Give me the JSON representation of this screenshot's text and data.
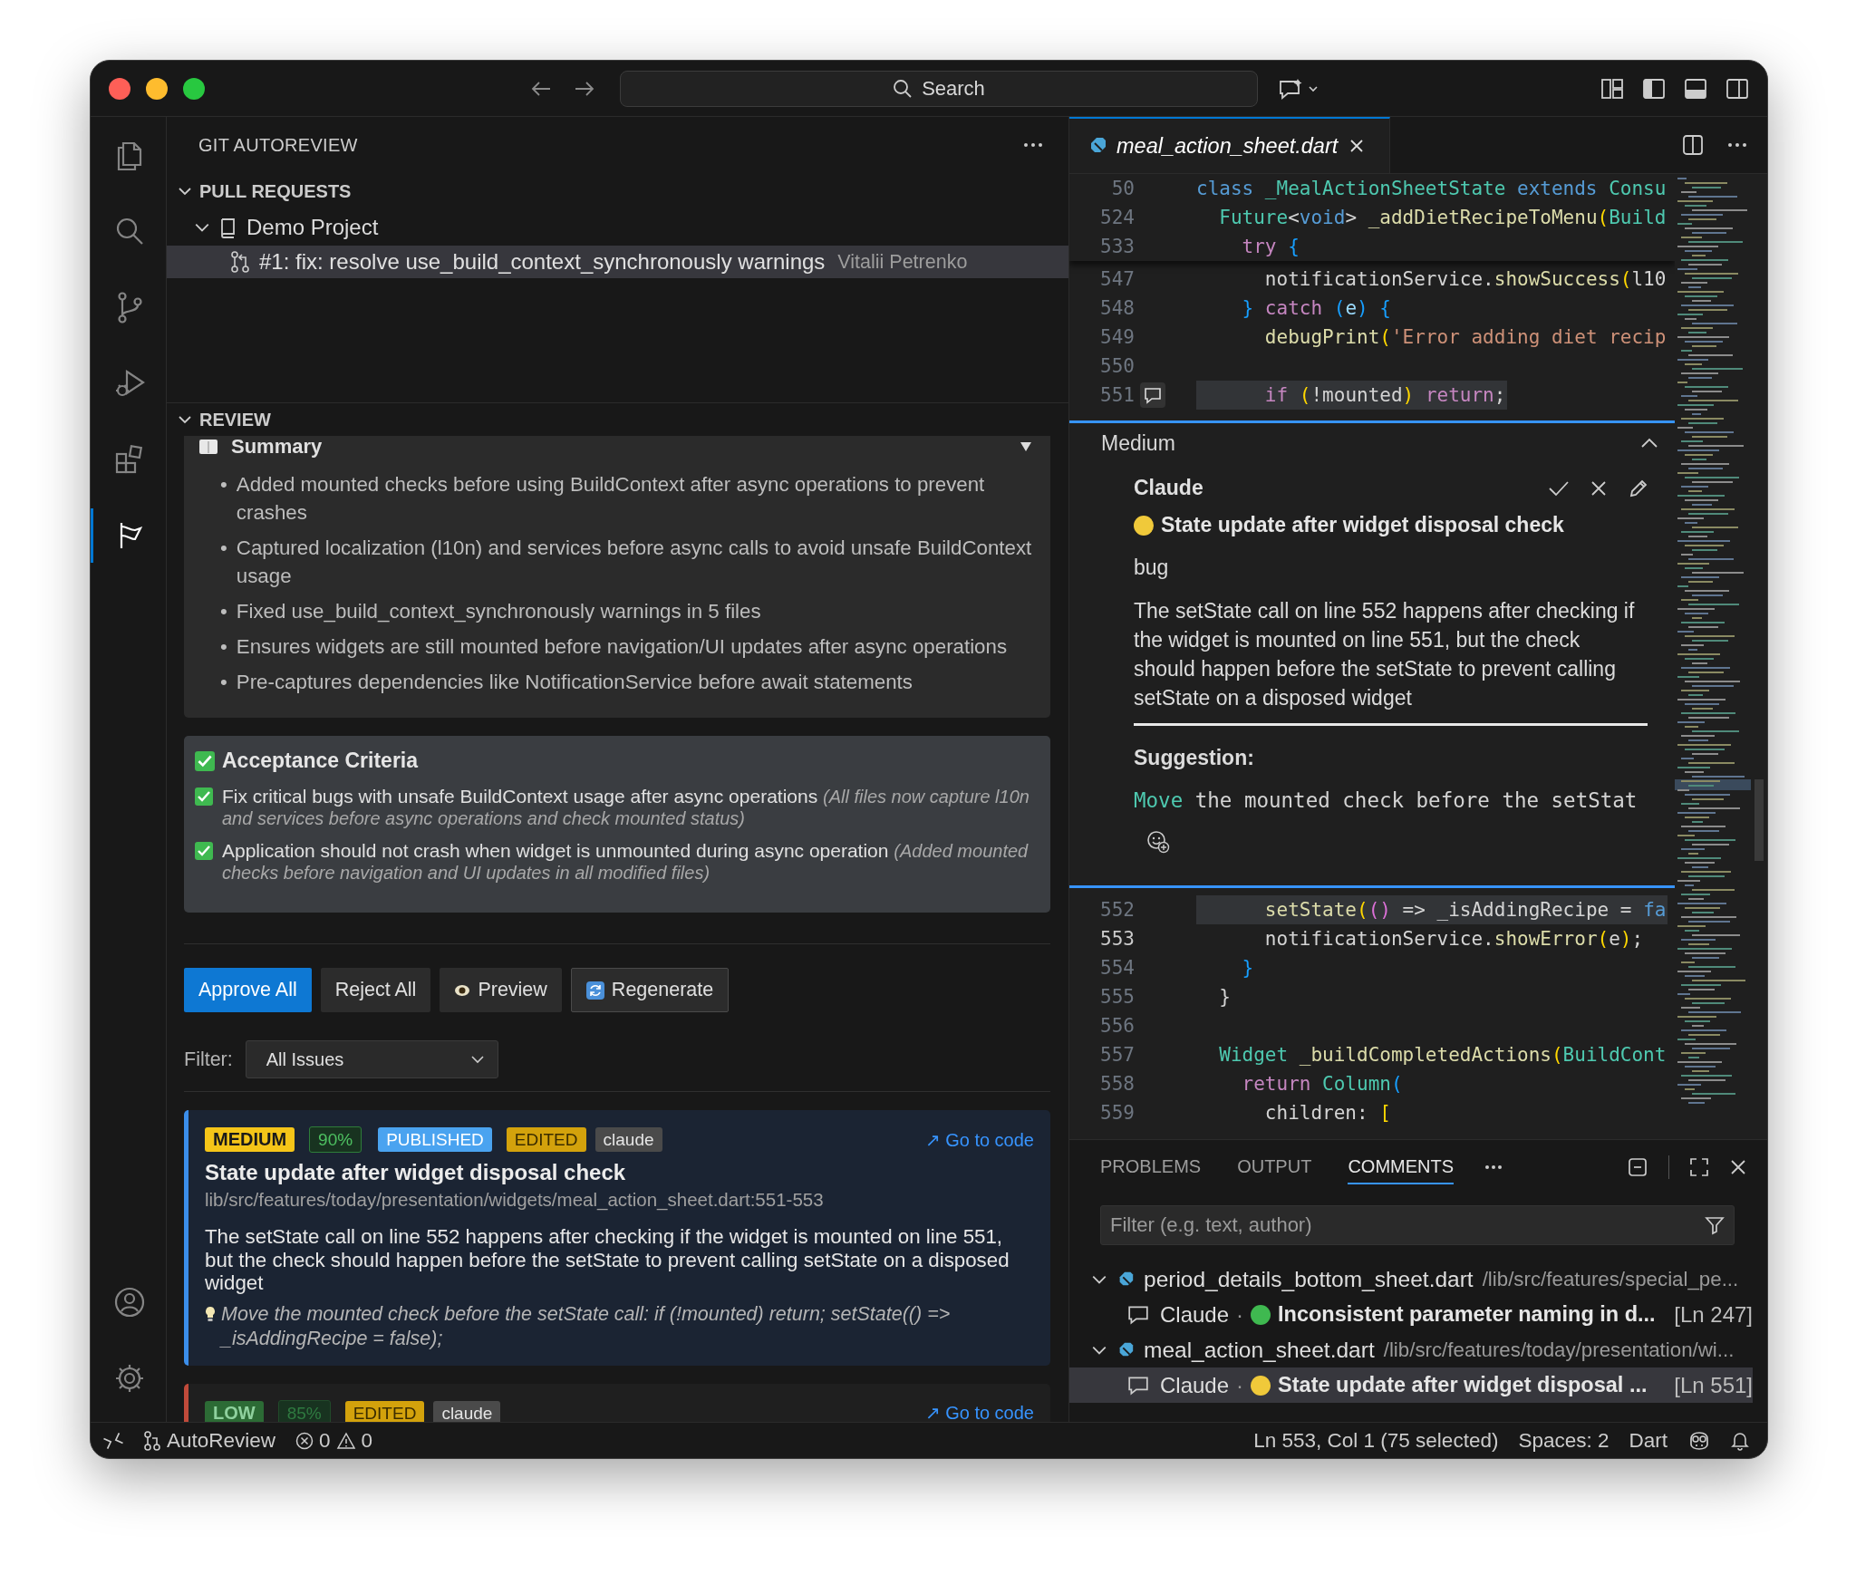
{
  "titlebar": {
    "search": "Search"
  },
  "activity_bar": {
    "top": [
      {
        "kind": "explorer",
        "selected": false
      },
      {
        "kind": "search",
        "selected": false
      },
      {
        "kind": "source_control",
        "selected": false
      },
      {
        "kind": "run_debug",
        "selected": false
      },
      {
        "kind": "extensions",
        "selected": false
      },
      {
        "kind": "autoreview",
        "selected": true
      }
    ],
    "bottom": [
      {
        "kind": "account"
      },
      {
        "kind": "settings"
      }
    ]
  },
  "sidebar": {
    "title": "GIT AUTOREVIEW",
    "pull_requests": {
      "label": "PULL REQUESTS",
      "expanded": true,
      "projects": [
        {
          "name": "Demo Project",
          "expanded": true,
          "children": [
            {
              "title": "#1: fix: resolve use_build_context_synchronously warnings",
              "author": "Vitalii Petrenko",
              "selected": true
            }
          ]
        }
      ]
    },
    "review": {
      "label": "REVIEW",
      "expanded": true,
      "summary": {
        "title": "Summary",
        "expanded": true,
        "bullet": "•",
        "items": [
          "Added mounted checks before using BuildContext after async operations to prevent crashes",
          "Captured localization (l10n) and services before async calls to avoid unsafe BuildContext usage",
          "Fixed use_build_context_synchronously warnings in 5 files",
          "Ensures widgets are still mounted before navigation/UI updates after async operations",
          "Pre-captures dependencies like NotificationService before await statements"
        ]
      },
      "acceptance": {
        "title": "Acceptance Criteria",
        "items": [
          {
            "text": "Fix critical bugs with unsafe BuildContext usage after async operations",
            "note": "(All files now capture l10n and services before async operations and check mounted status)",
            "checked": true
          },
          {
            "text": "Application should not crash when widget is unmounted during async operation",
            "note": "(Added mounted checks before navigation and UI updates in all modified files)",
            "checked": true
          }
        ]
      },
      "actions": [
        {
          "label": "Approve All",
          "kind": "primary"
        },
        {
          "label": "Reject All",
          "kind": "secondary"
        },
        {
          "label": "Preview",
          "kind": "preview"
        },
        {
          "label": "Regenerate",
          "kind": "regenerate"
        }
      ],
      "filter": {
        "label": "Filter:",
        "value": "All Issues"
      },
      "issues": [
        {
          "severity": "MEDIUM",
          "kind": "medium",
          "confidence": "90%",
          "tags": [
            {
              "label": "PUBLISHED",
              "kind": "published"
            },
            {
              "label": "EDITED",
              "kind": "edited"
            },
            {
              "label": "claude",
              "kind": "model"
            }
          ],
          "link": "↗ Go to code",
          "title": "State update after widget disposal check",
          "location": "lib/src/features/today/presentation/widgets/meal_action_sheet.dart:551-553",
          "description": "The setState call on line 552 happens after checking if the widget is mounted on line 551, but the check should happen before the setState to prevent calling setState on a disposed widget",
          "suggestion": "Move the mounted check before the setState call: if (!mounted) return; setState(() => _isAddingRecipe = false);"
        },
        {
          "severity": "LOW",
          "kind": "low",
          "confidence": "85%",
          "tags": [
            {
              "label": "EDITED",
              "kind": "edited"
            },
            {
              "label": "claude",
              "kind": "model"
            }
          ],
          "link": "↗ Go to code"
        }
      ]
    }
  },
  "editor": {
    "tab": {
      "name": "meal_action_sheet.dart",
      "selected": true
    },
    "sticky": [
      {
        "number": "50",
        "selected": false,
        "current": false,
        "tokens": [
          {
            "text": "class ",
            "kind": "kw"
          },
          {
            "text": "_MealActionSheetState ",
            "kind": "type"
          },
          {
            "text": "extends ",
            "kind": "kw"
          },
          {
            "text": "Consu",
            "kind": "type"
          }
        ]
      },
      {
        "number": "524",
        "selected": false,
        "current": false,
        "tokens": [
          {
            "text": "  Future",
            "kind": "type"
          },
          {
            "text": "<",
            "kind": "plain"
          },
          {
            "text": "void",
            "kind": "kw"
          },
          {
            "text": "> ",
            "kind": "plain"
          },
          {
            "text": "_addDietRecipeToMenu",
            "kind": "fn"
          },
          {
            "text": "(",
            "kind": "b1"
          },
          {
            "text": "Build",
            "kind": "type"
          }
        ]
      },
      {
        "number": "533",
        "selected": false,
        "current": false,
        "tokens": [
          {
            "text": "    try ",
            "kind": "ctl"
          },
          {
            "text": "{",
            "kind": "b3"
          }
        ]
      }
    ],
    "lines_before": [
      {
        "number": "547",
        "selected": false,
        "current": false,
        "commented": false,
        "tokens": [
          {
            "text": "      notificationService.",
            "kind": "plain"
          },
          {
            "text": "showSuccess",
            "kind": "fn"
          },
          {
            "text": "(",
            "kind": "b1"
          },
          {
            "text": "l10",
            "kind": "plain"
          }
        ]
      },
      {
        "number": "548",
        "selected": false,
        "current": false,
        "commented": false,
        "tokens": [
          {
            "text": "    } ",
            "kind": "b3"
          },
          {
            "text": "catch ",
            "kind": "ctl"
          },
          {
            "text": "(",
            "kind": "b3"
          },
          {
            "text": "e",
            "kind": "var"
          },
          {
            "text": ") ",
            "kind": "b3"
          },
          {
            "text": "{",
            "kind": "b3"
          }
        ]
      },
      {
        "number": "549",
        "selected": false,
        "current": false,
        "commented": false,
        "tokens": [
          {
            "text": "      debugPrint",
            "kind": "fn"
          },
          {
            "text": "(",
            "kind": "b1"
          },
          {
            "text": "'Error adding diet recip",
            "kind": "str"
          }
        ]
      },
      {
        "number": "550",
        "current": false
      },
      {
        "number": "551",
        "selected": true,
        "current": false,
        "commented": true,
        "tokens": [
          {
            "text": "      if ",
            "kind": "ctl"
          },
          {
            "text": "(",
            "kind": "b1"
          },
          {
            "text": "!mounted",
            "kind": "plain"
          },
          {
            "text": ") ",
            "kind": "b1"
          },
          {
            "text": "return",
            "kind": "ctl"
          },
          {
            "text": ";",
            "kind": "plain"
          }
        ]
      }
    ],
    "thread": {
      "title": "Medium",
      "expanded": true,
      "author": "Claude",
      "color": "#f0c93a",
      "heading": "State update after widget disposal check",
      "label": "bug",
      "body": "The setState call on line 552 happens after checking if the widget is mounted on line 551, but the check should happen before the setState to prevent calling setState on a disposed widget",
      "suggestion_label": "Suggestion:",
      "suggestion": [
        {
          "text": "Move",
          "kind": "type"
        },
        {
          "text": " the mounted check before the setStat",
          "kind": "plain"
        }
      ]
    },
    "lines_after": [
      {
        "number": "552",
        "selected": true,
        "current": false,
        "tokens": [
          {
            "text": "      setState",
            "kind": "fn"
          },
          {
            "text": "(",
            "kind": "b1"
          },
          {
            "text": "()",
            "kind": "b2"
          },
          {
            "text": " => _isAddingRecipe = ",
            "kind": "plain"
          },
          {
            "text": "fa",
            "kind": "kw"
          }
        ]
      },
      {
        "number": "553",
        "selected": false,
        "current": true,
        "tokens": [
          {
            "text": "      notificationService.",
            "kind": "plain"
          },
          {
            "text": "showError",
            "kind": "fn"
          },
          {
            "text": "(",
            "kind": "b1"
          },
          {
            "text": "e",
            "kind": "plain"
          },
          {
            "text": ")",
            "kind": "b1"
          },
          {
            "text": ";",
            "kind": "plain"
          }
        ]
      },
      {
        "number": "554",
        "selected": false,
        "current": false,
        "tokens": [
          {
            "text": "    }",
            "kind": "b3"
          }
        ]
      },
      {
        "number": "555",
        "selected": false,
        "current": false,
        "tokens": [
          {
            "text": "  }",
            "kind": "plain"
          }
        ]
      },
      {
        "number": "556",
        "current": false
      },
      {
        "number": "557",
        "selected": false,
        "current": false,
        "tokens": [
          {
            "text": "  Widget ",
            "kind": "type"
          },
          {
            "text": "_buildCompletedActions",
            "kind": "fn"
          },
          {
            "text": "(",
            "kind": "b1"
          },
          {
            "text": "BuildCont",
            "kind": "type"
          }
        ]
      },
      {
        "number": "558",
        "selected": false,
        "current": false,
        "tokens": [
          {
            "text": "    return ",
            "kind": "ctl"
          },
          {
            "text": "Column",
            "kind": "type"
          },
          {
            "text": "(",
            "kind": "b3"
          }
        ]
      },
      {
        "number": "559",
        "selected": false,
        "current": false,
        "tokens": [
          {
            "text": "      children: ",
            "kind": "plain"
          },
          {
            "text": "[",
            "kind": "b1"
          }
        ]
      }
    ]
  },
  "panel": {
    "tabs": [
      {
        "label": "PROBLEMS",
        "selected": false
      },
      {
        "label": "OUTPUT",
        "selected": false
      },
      {
        "label": "COMMENTS",
        "selected": true
      }
    ],
    "filter_placeholder": "Filter (e.g. text, author)",
    "files": [
      {
        "name": "period_details_bottom_sheet.dart",
        "path": "/lib/src/features/special_pe...",
        "expanded": true,
        "comments": [
          {
            "author": "Claude",
            "separator": "·",
            "color": "#3fb950",
            "title": "Inconsistent parameter naming in d...",
            "line": "[Ln 247]",
            "selected": false
          }
        ]
      },
      {
        "name": "meal_action_sheet.dart",
        "path": "/lib/src/features/today/presentation/wi...",
        "expanded": true,
        "comments": [
          {
            "author": "Claude",
            "separator": "·",
            "color": "#f0c93a",
            "title": "State update after widget disposal ...",
            "line": "[Ln 551]",
            "selected": true
          }
        ]
      }
    ]
  },
  "statusbar": {
    "branch": "AutoReview",
    "errors": "0",
    "warnings": "0",
    "cursor": "Ln 553, Col 1 (75 selected)",
    "indent": "Spaces: 2",
    "language": "Dart"
  }
}
